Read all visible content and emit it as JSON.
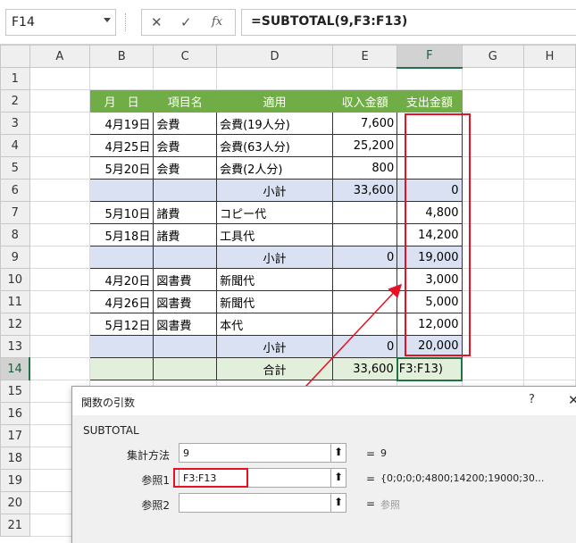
{
  "formula_bar": {
    "name_box": "F14",
    "cancel_icon": "✕",
    "enter_icon": "✓",
    "fx_label": "fx",
    "formula": "=SUBTOTAL(9,F3:F13)"
  },
  "sheet": {
    "columns": [
      "A",
      "B",
      "C",
      "D",
      "E",
      "F",
      "G",
      "H"
    ],
    "headers": [
      "月　日",
      "項目名",
      "適用",
      "収入金額",
      "支出金額"
    ],
    "rows": [
      {
        "n": "3",
        "date": "4月19日",
        "item": "会費",
        "desc": "会費(19人分)",
        "income": "7,600",
        "expense": ""
      },
      {
        "n": "4",
        "date": "4月25日",
        "item": "会費",
        "desc": "会費(63人分)",
        "income": "25,200",
        "expense": ""
      },
      {
        "n": "5",
        "date": "5月20日",
        "item": "会費",
        "desc": "会費(2人分)",
        "income": "800",
        "expense": ""
      },
      {
        "n": "6",
        "subtotal": true,
        "desc": "小計",
        "income": "33,600",
        "expense": "0"
      },
      {
        "n": "7",
        "date": "5月10日",
        "item": "諸費",
        "desc": "コピー代",
        "income": "",
        "expense": "4,800"
      },
      {
        "n": "8",
        "date": "5月18日",
        "item": "諸費",
        "desc": "工具代",
        "income": "",
        "expense": "14,200"
      },
      {
        "n": "9",
        "subtotal": true,
        "desc": "小計",
        "income": "0",
        "expense": "19,000"
      },
      {
        "n": "10",
        "date": "4月20日",
        "item": "図書費",
        "desc": "新聞代",
        "income": "",
        "expense": "3,000"
      },
      {
        "n": "11",
        "date": "4月26日",
        "item": "図書費",
        "desc": "新聞代",
        "income": "",
        "expense": "5,000"
      },
      {
        "n": "12",
        "date": "5月12日",
        "item": "図書費",
        "desc": "本代",
        "income": "",
        "expense": "12,000"
      },
      {
        "n": "13",
        "subtotal": true,
        "desc": "小計",
        "income": "0",
        "expense": "20,000"
      }
    ],
    "total": {
      "n": "14",
      "desc": "合計",
      "income": "33,600",
      "expense": "F3:F13)"
    },
    "extra_rows": [
      "15",
      "16",
      "17",
      "18",
      "19",
      "20",
      "21"
    ]
  },
  "dialog": {
    "title": "関数の引数",
    "help": "?",
    "close": "✕",
    "function_name": "SUBTOTAL",
    "args": [
      {
        "label": "集計方法",
        "value": "9",
        "eq": "=",
        "result": "9"
      },
      {
        "label": "参照1",
        "value": "F3:F13",
        "eq": "=",
        "result": "{0;0;0;0;4800;14200;19000;30..."
      },
      {
        "label": "参照2",
        "value": "",
        "eq": "=",
        "result": "参照"
      }
    ],
    "ref_button_icon": "⬆"
  },
  "colors": {
    "header_green": "#70ad47",
    "subtotal_blue": "#d9e1f2",
    "total_green": "#e2efda",
    "highlight_red": "#e81123",
    "selection_green": "#217346"
  }
}
